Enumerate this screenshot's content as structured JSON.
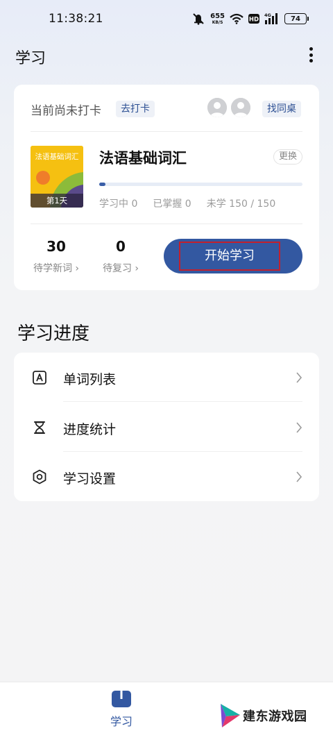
{
  "status_bar": {
    "time": "11:38:21",
    "net_speed_value": "655",
    "net_speed_unit": "KB/S",
    "hd_label": "HD",
    "network_label": "4G",
    "battery_level": "74",
    "icons": [
      "mute-icon",
      "wifi-icon",
      "hd-icon",
      "signal-icon",
      "battery-icon"
    ]
  },
  "header": {
    "title": "学习",
    "more_icon": "more-vertical-icon"
  },
  "checkin": {
    "status_text": "当前尚未打卡",
    "checkin_label": "去打卡",
    "deskmate_label": "找同桌"
  },
  "book": {
    "cover_title": "法语基础词汇",
    "cover_day": "第1天",
    "title": "法语基础词汇",
    "change_label": "更换",
    "progress": 0.03,
    "stats": {
      "learning": "学习中 0",
      "mastered": "已掌握 0",
      "unlearned": "未学 150 / 150"
    }
  },
  "counts": {
    "new_words_value": "30",
    "new_words_label": "待学新词 ›",
    "review_value": "0",
    "review_label": "待复习 ›"
  },
  "start_button": {
    "label": "开始学习",
    "color": "#3358a1",
    "highlight_color": "#c2202d"
  },
  "progress_section": {
    "title": "学习进度",
    "items": [
      {
        "label": "单词列表",
        "icon": "word-list-icon"
      },
      {
        "label": "进度统计",
        "icon": "hourglass-icon"
      },
      {
        "label": "学习设置",
        "icon": "settings-hexagon-icon"
      }
    ]
  },
  "tab_bar": {
    "active_tab": "学习",
    "active_color": "#3358a1"
  },
  "watermark": {
    "text": "建东游戏园"
  }
}
